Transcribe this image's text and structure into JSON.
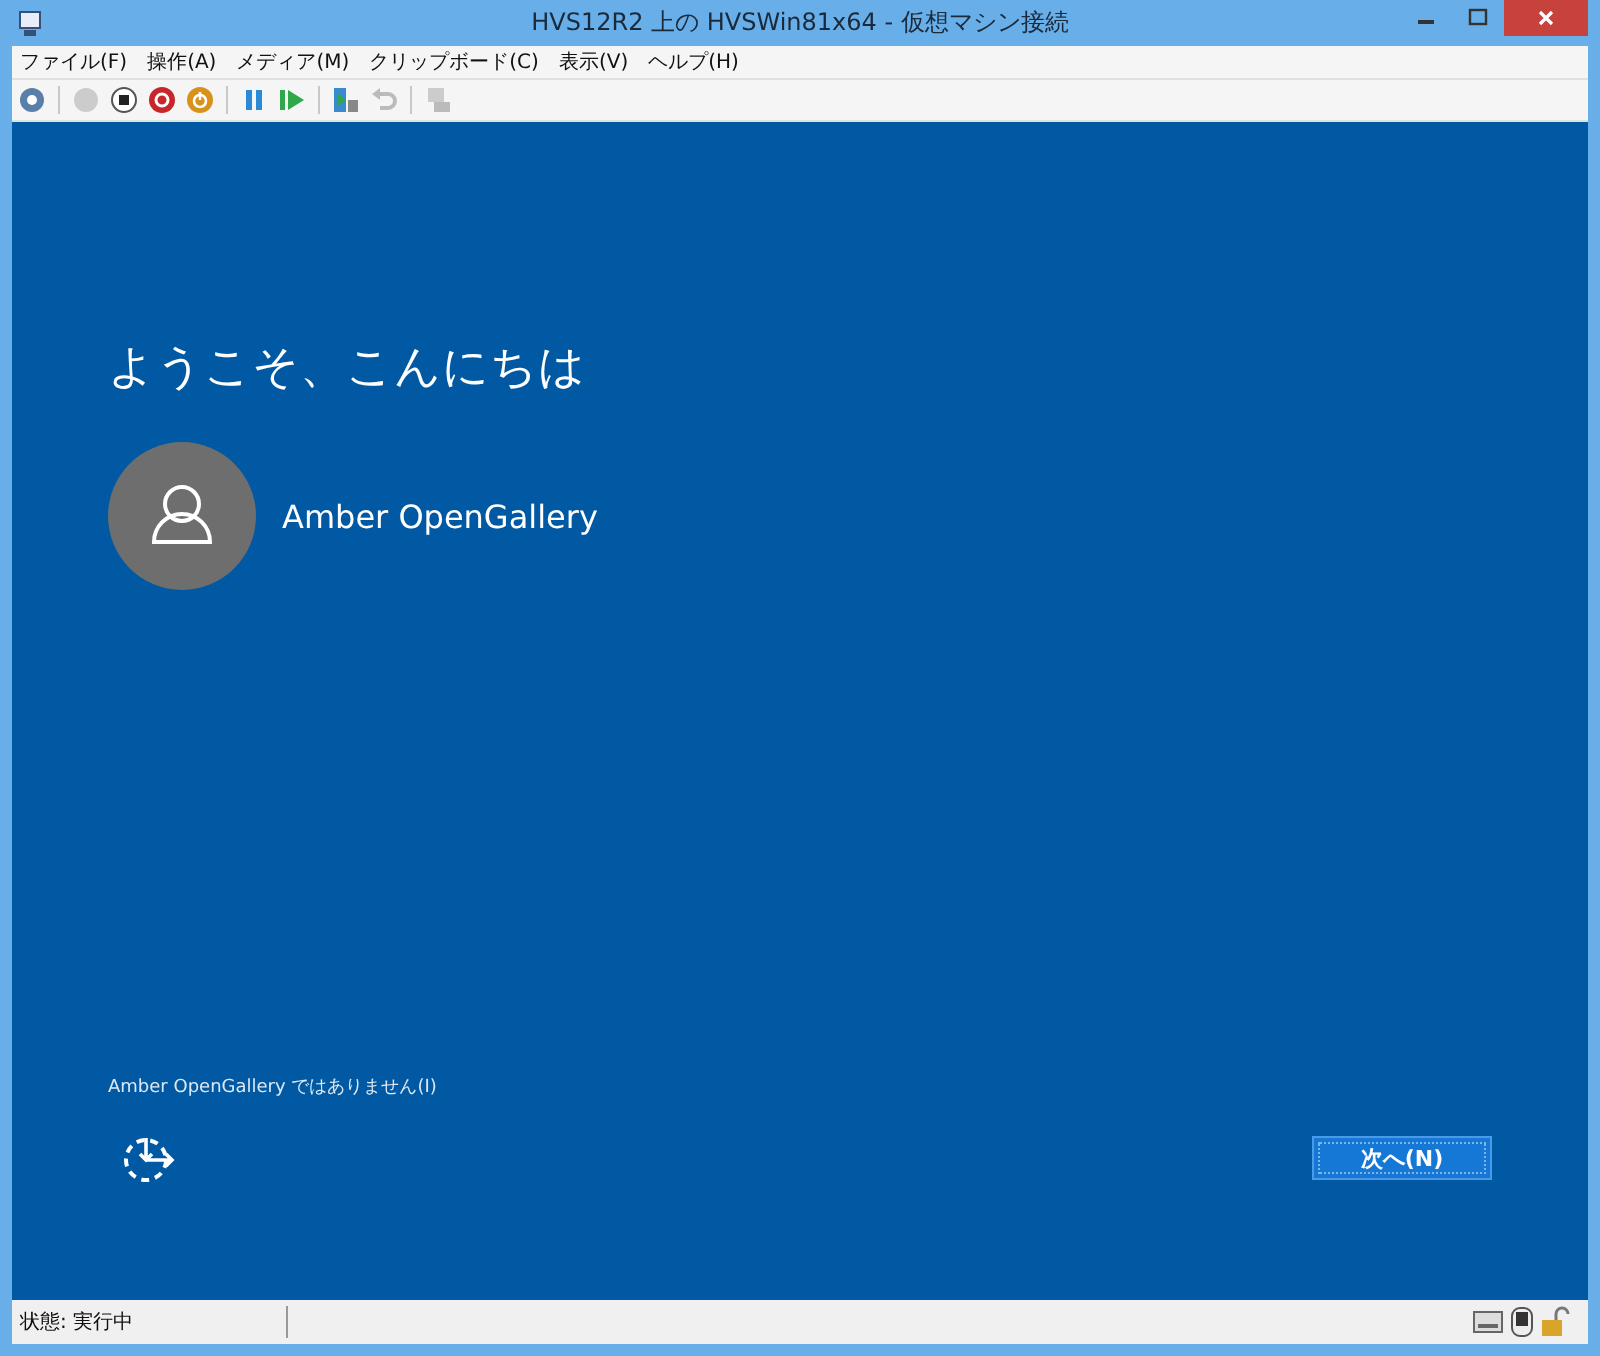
{
  "window": {
    "title": "HVS12R2 上の HVSWin81x64  - 仮想マシン接続"
  },
  "menu": [
    {
      "label": "ファイル(F)"
    },
    {
      "label": "操作(A)"
    },
    {
      "label": "メディア(M)"
    },
    {
      "label": "クリップボード(C)"
    },
    {
      "label": "表示(V)"
    },
    {
      "label": "ヘルプ(H)"
    }
  ],
  "screen": {
    "greeting": "ようこそ、こんにちは",
    "user_name": "Amber OpenGallery",
    "not_me_link": "Amber OpenGallery ではありません(I)",
    "next_button": "次へ(N)"
  },
  "status_bar": {
    "status": "状態: 実行中"
  }
}
